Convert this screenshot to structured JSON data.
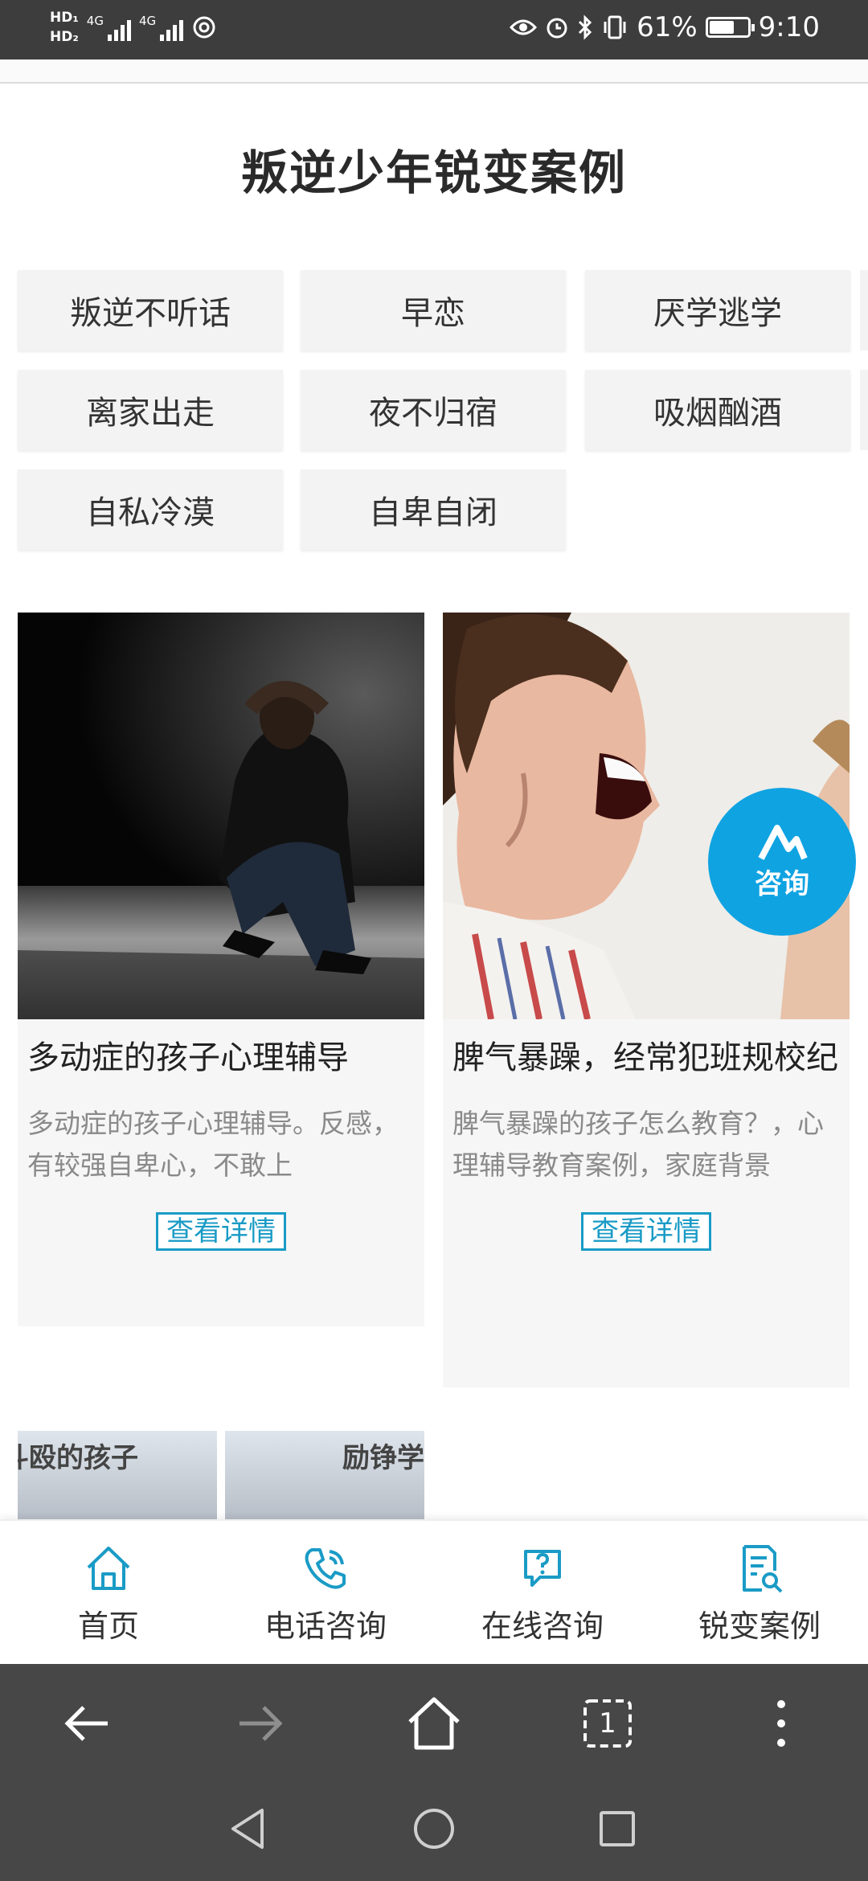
{
  "status_bar": {
    "hd1": "HD₁",
    "hd2": "HD₂",
    "net1": "4G",
    "net2": "4G",
    "battery": "61%",
    "battery_level": 0.61,
    "time": "9:10"
  },
  "page": {
    "title": "叛逆少年锐变案例"
  },
  "tags": [
    "叛逆不听话",
    "早恋",
    "厌学逃学",
    "离家出走",
    "夜不归宿",
    "吸烟酗酒",
    "自私冷漠",
    "自卑自闭"
  ],
  "cards": [
    {
      "title": "多动症的孩子心理辅导",
      "desc": "多动症的孩子心理辅导。反感，有较强自卑心，不敢上",
      "button": "查看详情"
    },
    {
      "title": "脾气暴躁，经常犯班规校纪",
      "desc": "脾气暴躁的孩子怎么教育？，心理辅导教育案例，家庭背景",
      "button": "查看详情"
    }
  ],
  "float_button": {
    "label": "咨询",
    "icon": "consult-logo-icon"
  },
  "thumbs": [
    "斗殴的孩子",
    "励铮学"
  ],
  "bottom_nav": [
    {
      "label": "首页",
      "icon": "home-icon"
    },
    {
      "label": "电话咨询",
      "icon": "phone-icon"
    },
    {
      "label": "在线咨询",
      "icon": "chat-question-icon"
    },
    {
      "label": "锐变案例",
      "icon": "document-search-icon"
    }
  ],
  "browser": {
    "tab_count": "1"
  },
  "colors": {
    "accent": "#1a9bc6",
    "float": "#0fa3e2",
    "statusbar": "#3d3d3d",
    "browserbar": "#474747"
  }
}
